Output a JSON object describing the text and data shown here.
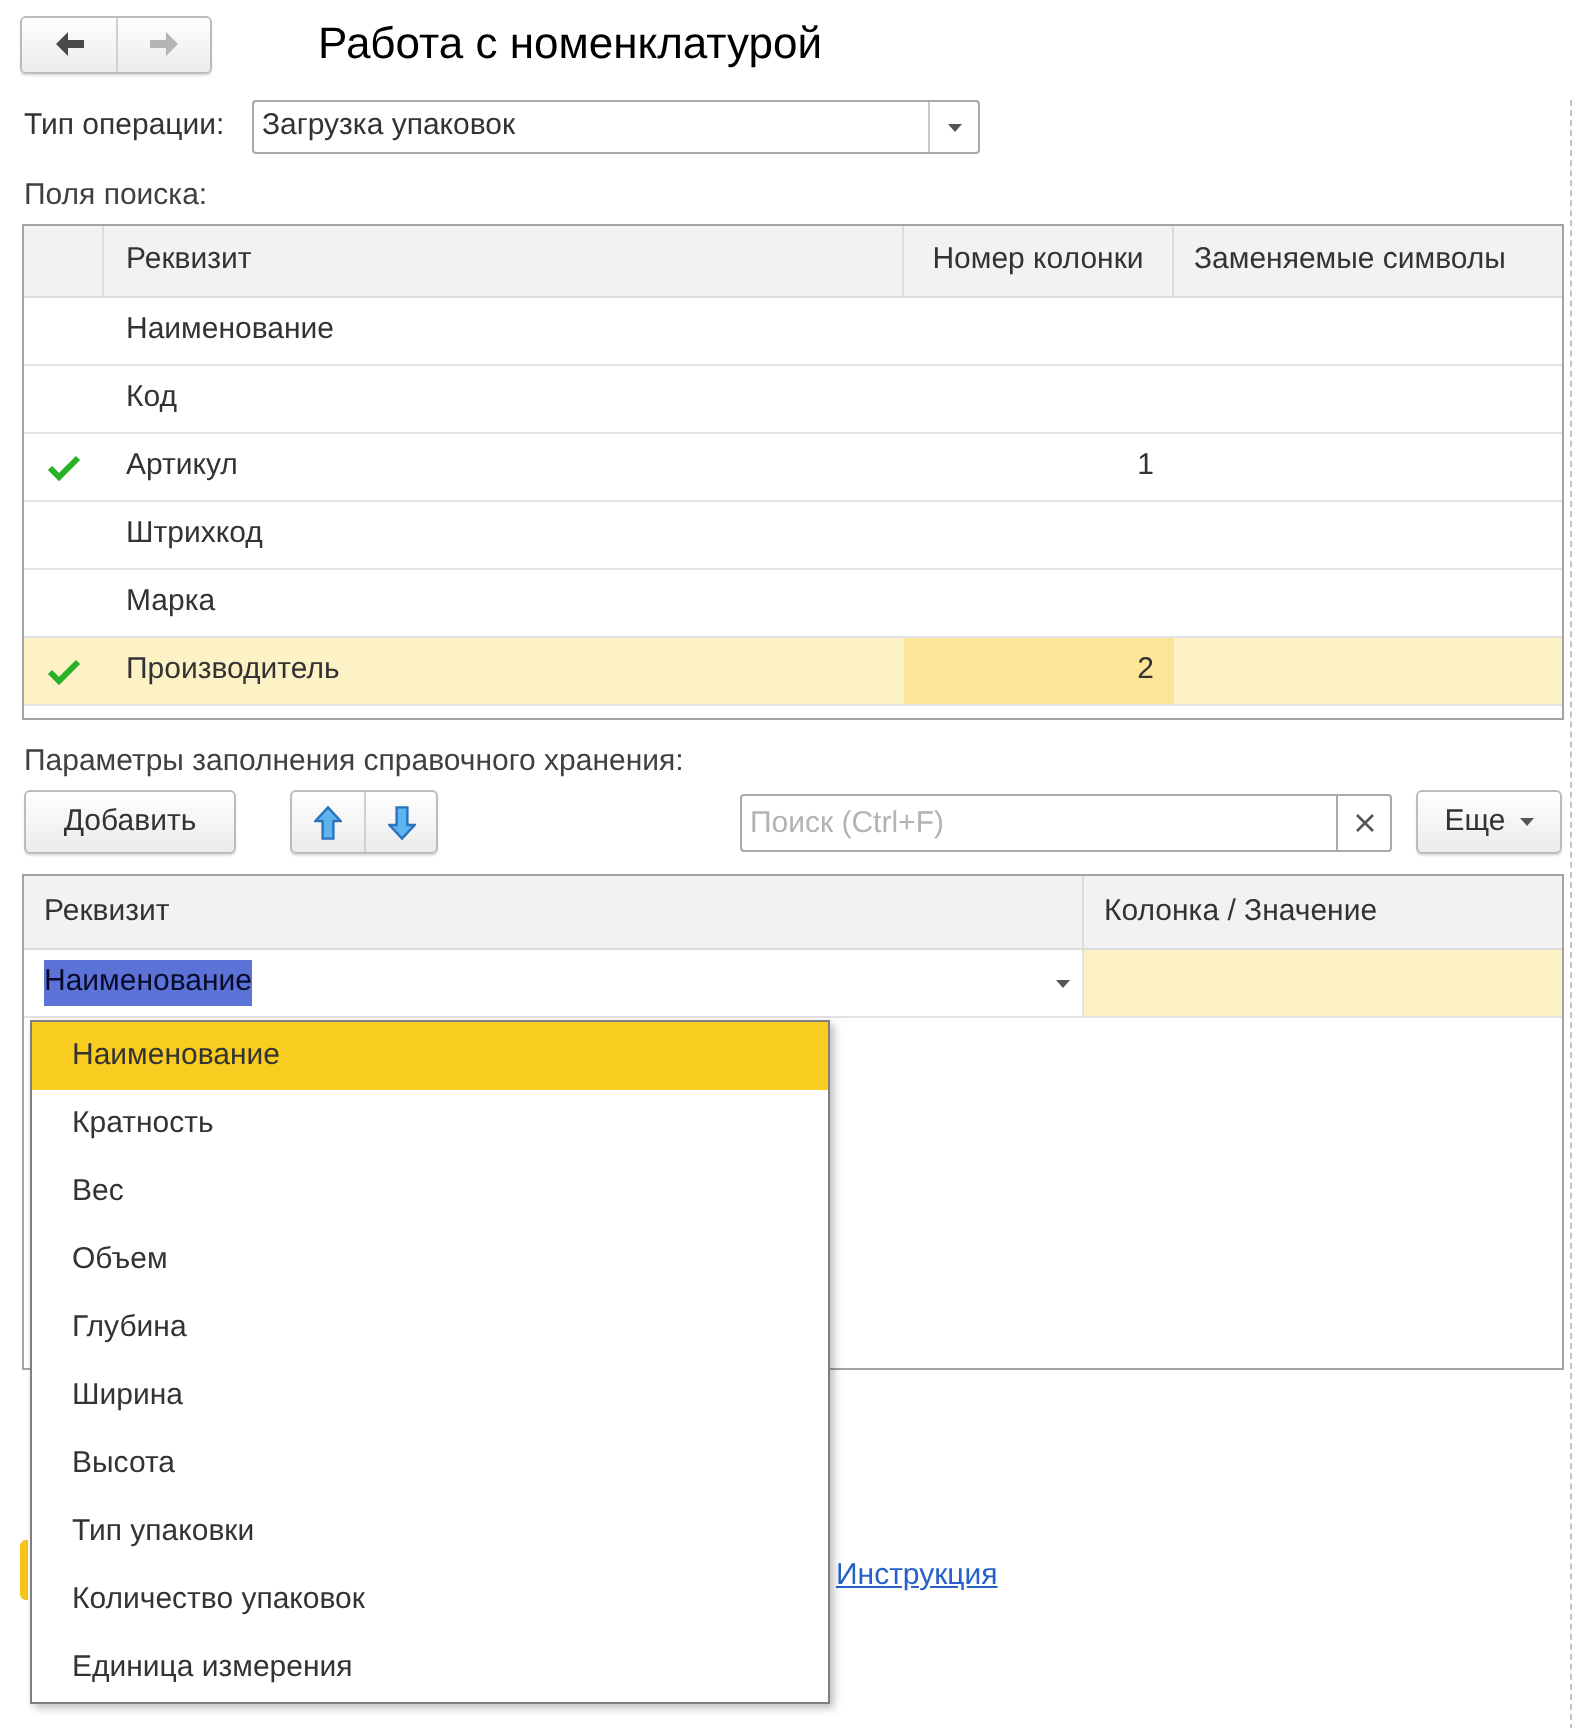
{
  "window": {
    "title": "Работа с номенклатурой"
  },
  "navigation": [
    {
      "kind": "back",
      "disabled": false
    },
    {
      "kind": "forward",
      "disabled": true
    }
  ],
  "operation_type": {
    "label": "Тип операции:",
    "value": "Загрузка упаковок"
  },
  "search_fields": {
    "label": "Поля поиска:",
    "columns": [
      "Реквизит",
      "Номер колонки",
      "Заменяемые символы"
    ],
    "rows": [
      {
        "checked": false,
        "selected": false,
        "attribute": "Наименование"
      },
      {
        "checked": false,
        "selected": false,
        "attribute": "Код"
      },
      {
        "checked": true,
        "selected": false,
        "attribute": "Артикул",
        "column_number": "1"
      },
      {
        "checked": false,
        "selected": false,
        "attribute": "Штрихкод"
      },
      {
        "checked": false,
        "selected": false,
        "attribute": "Марка"
      },
      {
        "checked": true,
        "selected": true,
        "attribute": "Производитель",
        "column_number": "2"
      }
    ]
  },
  "fill_parameters": {
    "label": "Параметры заполнения справочного хранения:",
    "toolbar": {
      "add_button": "Добавить",
      "search_placeholder": "Поиск (Ctrl+F)",
      "more_button": "Еще"
    },
    "columns": [
      "Реквизит",
      "Колонка / Значение"
    ],
    "rows": [
      {
        "attribute": "Наименование",
        "selected": true
      }
    ]
  },
  "dropdown": {
    "items": [
      {
        "label": "Наименование",
        "selected": true
      },
      {
        "label": "Кратность",
        "selected": false
      },
      {
        "label": "Вес",
        "selected": false
      },
      {
        "label": "Объем",
        "selected": false
      },
      {
        "label": "Глубина",
        "selected": false
      },
      {
        "label": "Ширина",
        "selected": false
      },
      {
        "label": "Высота",
        "selected": false
      },
      {
        "label": "Тип упаковки",
        "selected": false
      },
      {
        "label": "Количество упаковок",
        "selected": false
      },
      {
        "label": "Единица измерения",
        "selected": false
      }
    ]
  },
  "instruction_link": "Инструкция"
}
